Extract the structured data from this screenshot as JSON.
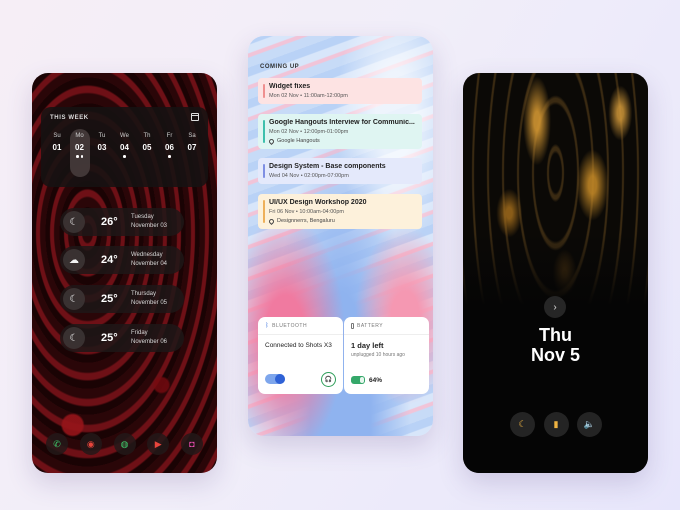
{
  "phone1": {
    "week_title": "THIS WEEK",
    "days": [
      {
        "name": "Su",
        "num": "01",
        "dots": 0,
        "active": false
      },
      {
        "name": "Mo",
        "num": "02",
        "dots": 2,
        "active": true
      },
      {
        "name": "Tu",
        "num": "03",
        "dots": 0,
        "active": false
      },
      {
        "name": "We",
        "num": "04",
        "dots": 1,
        "active": false
      },
      {
        "name": "Th",
        "num": "05",
        "dots": 0,
        "active": false
      },
      {
        "name": "Fr",
        "num": "06",
        "dots": 1,
        "active": false
      },
      {
        "name": "Sa",
        "num": "07",
        "dots": 0,
        "active": false
      }
    ],
    "weather": [
      {
        "icon": "moon-icon",
        "glyph": "☾",
        "temp": "26°",
        "day": "Tuesday",
        "date": "November 03"
      },
      {
        "icon": "cloud-icon",
        "glyph": "☁",
        "temp": "24°",
        "day": "Wednesday",
        "date": "November 04"
      },
      {
        "icon": "moon-icon",
        "glyph": "☾",
        "temp": "25°",
        "day": "Thursday",
        "date": "November 05"
      },
      {
        "icon": "moon-icon",
        "glyph": "☾",
        "temp": "25°",
        "day": "Friday",
        "date": "November 06"
      }
    ],
    "dock": [
      {
        "icon": "phone-icon",
        "glyph": "✆",
        "color": "#3ecf6e"
      },
      {
        "icon": "chrome-icon",
        "glyph": "◉",
        "color": "#e8453c"
      },
      {
        "icon": "spotify-icon",
        "glyph": "◍",
        "color": "#3ecf6e"
      },
      {
        "icon": "youtube-icon",
        "glyph": "▶",
        "color": "#e8453c"
      },
      {
        "icon": "camera-icon",
        "glyph": "◘",
        "color": "#e84cb0"
      }
    ]
  },
  "phone2": {
    "section_title": "COMING UP",
    "events": [
      {
        "title": "Widget fixes",
        "time": "Mon 02 Nov • 11:00am-12:00pm",
        "location": "",
        "bg": "#fde3e3",
        "bar": "#ef8f8f"
      },
      {
        "title": "Google Hangouts Interview for Communic...",
        "time": "Mon 02 Nov • 12:00pm-01:00pm",
        "location": "Google Hangouts",
        "bg": "#dff5f2",
        "bar": "#3ec0ad"
      },
      {
        "title": "Design System - Base components",
        "time": "Wed 04 Nov • 02:00pm-07:00pm",
        "location": "",
        "bg": "#e4e9fb",
        "bar": "#7f8fe3"
      },
      {
        "title": "UI/UX Design Workshop 2020",
        "time": "Fri 06 Nov • 10:00am-04:00pm",
        "location": "Designnerrs, Bengaluru",
        "bg": "#fdf1db",
        "bar": "#eeb05a"
      }
    ],
    "bluetooth": {
      "label": "BLUETOOTH",
      "status": "Connected to Shots X3"
    },
    "battery": {
      "label": "BATTERY",
      "time_left": "1 day left",
      "unplugged": "unplugged 10 hours ago",
      "percent": "64%",
      "level": 0.64
    }
  },
  "phone3": {
    "day": "Thu",
    "date": "Nov 5",
    "controls": [
      {
        "icon": "moon-icon",
        "glyph": "☾"
      },
      {
        "icon": "flashlight-icon",
        "glyph": "▮"
      },
      {
        "icon": "volume-icon",
        "glyph": "🔈"
      }
    ]
  }
}
